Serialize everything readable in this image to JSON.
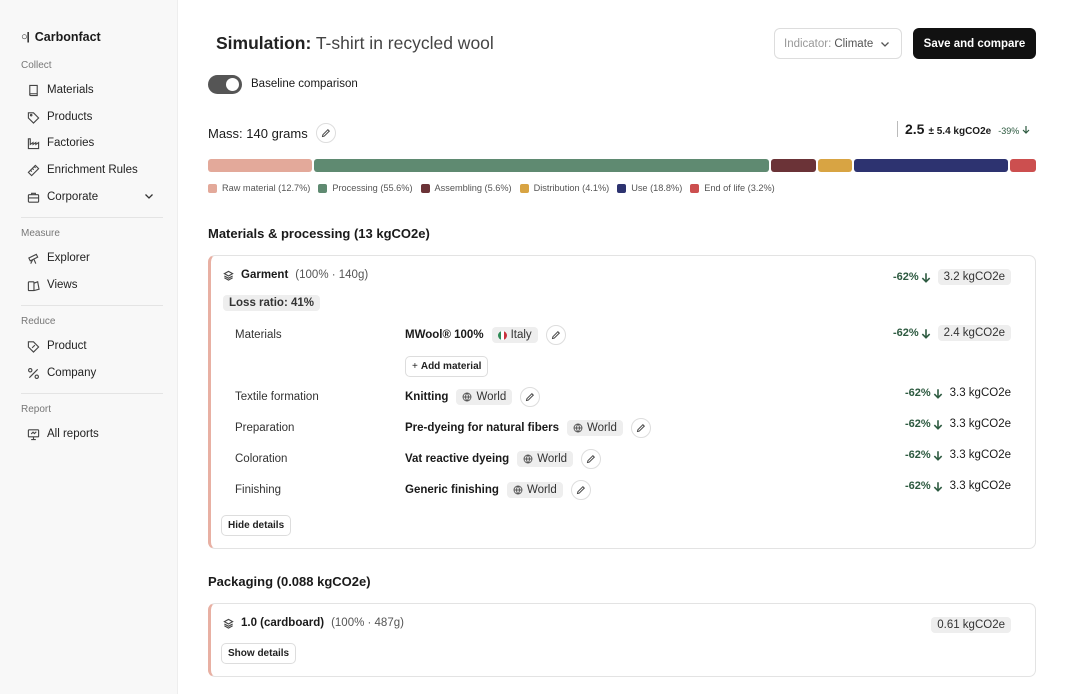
{
  "app": {
    "brand": "Carbonfact",
    "brand_mark": "○|"
  },
  "sidebar": {
    "sections": [
      {
        "title": "Collect",
        "items": [
          {
            "label": "Materials",
            "icon": "book-icon"
          },
          {
            "label": "Products",
            "icon": "tag-icon"
          },
          {
            "label": "Factories",
            "icon": "factory-icon"
          },
          {
            "label": "Enrichment Rules",
            "icon": "ruler-icon"
          },
          {
            "label": "Corporate",
            "icon": "briefcase-icon",
            "expandable": true
          }
        ]
      },
      {
        "title": "Measure",
        "items": [
          {
            "label": "Explorer",
            "icon": "telescope-icon"
          },
          {
            "label": "Views",
            "icon": "views-icon"
          }
        ]
      },
      {
        "title": "Reduce",
        "items": [
          {
            "label": "Product",
            "icon": "tag-percent-icon"
          },
          {
            "label": "Company",
            "icon": "percent-icon"
          }
        ]
      },
      {
        "title": "Report",
        "items": [
          {
            "label": "All reports",
            "icon": "presentation-icon"
          }
        ]
      }
    ]
  },
  "header": {
    "title_bold": "Simulation:",
    "title_rest": " T-shirt in recycled wool",
    "indicator_prefix": "Indicator:",
    "indicator_value": "Climate",
    "save_label": "Save and compare"
  },
  "baseline": {
    "label": "Baseline comparison",
    "enabled": true
  },
  "mass": {
    "label": "Mass: 140 grams"
  },
  "score": {
    "value": "2.5",
    "uncertainty": "± 5.4 kgCO2e",
    "delta": "-39%"
  },
  "breakdown": [
    {
      "label": "Raw material (12.7%)",
      "share": 12.7,
      "color": "#e3a99a"
    },
    {
      "label": "Processing (55.6%)",
      "share": 55.6,
      "color": "#5f8a71"
    },
    {
      "label": "Assembling (5.6%)",
      "share": 5.6,
      "color": "#6b3337"
    },
    {
      "label": "Distribution (4.1%)",
      "share": 4.1,
      "color": "#d8a443"
    },
    {
      "label": "Use (18.8%)",
      "share": 18.8,
      "color": "#2d3370"
    },
    {
      "label": "End of life (3.2%)",
      "share": 3.2,
      "color": "#cc4f4f"
    }
  ],
  "materials_section": {
    "title": "Materials & processing (13 kgCO2e)",
    "garment": {
      "name": "Garment",
      "meta": "(100% · 140g)",
      "delta": "-62%",
      "value": "3.2 kgCO2e",
      "loss_ratio": "Loss ratio: 41%"
    },
    "rows": [
      {
        "label": "Materials",
        "value": "MWool® 100%",
        "origin": "Italy",
        "origin_type": "flag",
        "delta": "-62%",
        "kg": "2.4 kgCO2e",
        "kg_chip": true
      },
      {
        "label": "Textile formation",
        "value": "Knitting",
        "origin": "World",
        "origin_type": "globe",
        "delta": "-62%",
        "kg": "3.3 kgCO2e"
      },
      {
        "label": "Preparation",
        "value": "Pre-dyeing for natural fibers",
        "origin": "World",
        "origin_type": "globe",
        "delta": "-62%",
        "kg": "3.3 kgCO2e"
      },
      {
        "label": "Coloration",
        "value": "Vat reactive dyeing",
        "origin": "World",
        "origin_type": "globe",
        "delta": "-62%",
        "kg": "3.3 kgCO2e"
      },
      {
        "label": "Finishing",
        "value": "Generic finishing",
        "origin": "World",
        "origin_type": "globe",
        "delta": "-62%",
        "kg": "3.3 kgCO2e"
      }
    ],
    "add_material": "Add material",
    "hide_details": "Hide details"
  },
  "packaging_section": {
    "title": "Packaging (0.088 kgCO2e)",
    "item": {
      "name": "1.0 (cardboard)",
      "meta": "(100% · 487g)",
      "value": "0.61 kgCO2e"
    },
    "show_details": "Show details"
  }
}
